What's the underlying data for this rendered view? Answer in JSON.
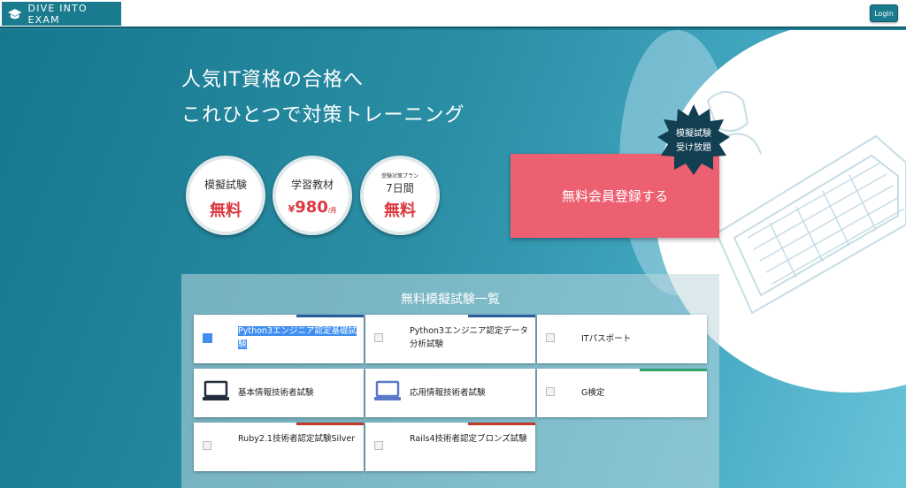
{
  "header": {
    "logo_text": "DIVE INTO EXAM",
    "login_label": "Login"
  },
  "hero": {
    "headline_1": "人気IT資格の合格へ",
    "headline_2": "これひとつで対策トレーニング",
    "badges": [
      {
        "top": "模擬試験",
        "big": "無料"
      },
      {
        "top": "学習教材",
        "yen": "¥",
        "big": "980",
        "unit": "/月"
      },
      {
        "small": "受験対策プラン",
        "top": "7日間",
        "big": "無料"
      }
    ],
    "register_label": "無料会員登録する",
    "burst_line_1": "模擬試験",
    "burst_line_2": "受け放題"
  },
  "exam_list": {
    "title": "無料模擬試験一覧",
    "cards": [
      {
        "label": "Python3エンジニア認定基礎試験",
        "accent": "#2a5d9c",
        "icon": "selected-image-icon"
      },
      {
        "label": "Python3エンジニア認定データ分析試験",
        "accent": "#2a5d9c",
        "icon": "broken-image-icon"
      },
      {
        "label": "ITパスポート",
        "accent": "none",
        "icon": "broken-image-icon"
      },
      {
        "label": "基本情報技術者試験",
        "accent": "none",
        "icon": "laptop-dark-icon"
      },
      {
        "label": "応用情報技術者試験",
        "accent": "none",
        "icon": "laptop-blue-icon"
      },
      {
        "label": "G検定",
        "accent": "#2ea36a",
        "icon": "broken-image-icon"
      },
      {
        "label": "Ruby2.1技術者認定試験Silver",
        "accent": "#c0392b",
        "icon": "broken-image-icon"
      },
      {
        "label": "Rails4技術者認定ブロンズ試験",
        "accent": "#c0392b",
        "icon": "broken-image-icon"
      }
    ]
  },
  "colors": {
    "brand": "#1a7b8f",
    "register": "#ec6071",
    "price_red": "#d9383f",
    "starburst": "#123f52"
  }
}
